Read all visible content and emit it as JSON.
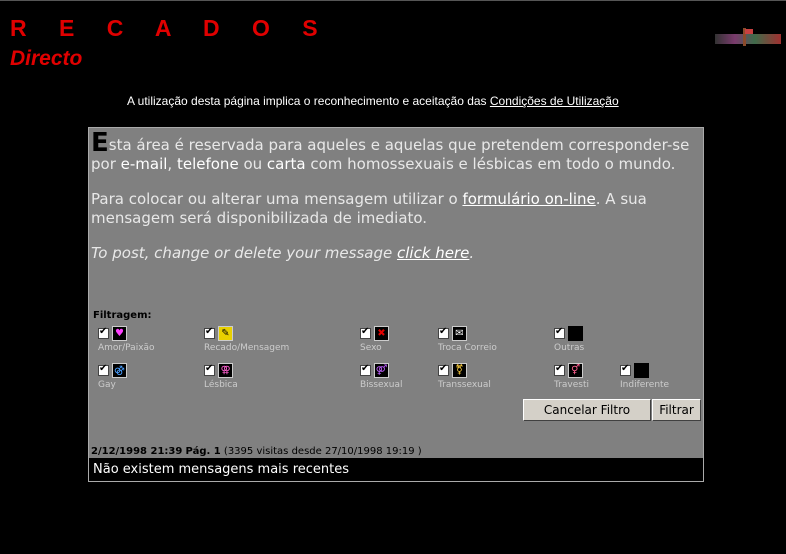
{
  "header": {
    "title": "R E C A D O S",
    "subtitle": "Directo"
  },
  "notice": {
    "text": "A utilização desta página implica o reconhecimento e aceitação das ",
    "link": "Condições de Utilização"
  },
  "intro": {
    "dropcap": "E",
    "p1_a": "sta área é reservada para aqueles e aquelas que pretendem corresponder-se por ",
    "email": "e-mail",
    "sep1": ", ",
    "phone": "telefone",
    "sep2": " ou ",
    "letter": "carta",
    "p1_b": " com homossexuais e lésbicas em todo o mundo.",
    "p2_a": "Para colocar ou alterar uma mensagem utilizar o ",
    "p2_link": "formulário on-line",
    "p2_b": ". A sua mensagem será disponibilizada de imediato.",
    "p3_a": "To post, change or delete your message ",
    "p3_link": "click here",
    "p3_b": "."
  },
  "filter": {
    "label": "Filtragem:",
    "items": [
      {
        "label": "Amor/Paixão",
        "icon": "heart-icon",
        "checked": true
      },
      {
        "label": "Recado/Mensagem",
        "icon": "note-icon",
        "checked": true
      },
      {
        "label": "Sexo",
        "icon": "sex-icon",
        "checked": true
      },
      {
        "label": "Troca Correio",
        "icon": "mail-icon",
        "checked": true
      },
      {
        "label": "Outras",
        "icon": "other-icon",
        "checked": true
      },
      {
        "label": "Gay",
        "icon": "gay-icon",
        "checked": true
      },
      {
        "label": "Lésbica",
        "icon": "lesbian-icon",
        "checked": true
      },
      {
        "label": "Bissexual",
        "icon": "bisexual-icon",
        "checked": true
      },
      {
        "label": "Transsexual",
        "icon": "transsexual-icon",
        "checked": true
      },
      {
        "label": "Travesti",
        "icon": "travesti-icon",
        "checked": true
      },
      {
        "label": "Indiferente",
        "icon": "indifferent-icon",
        "checked": true
      }
    ],
    "cancel_button": "Cancelar Filtro",
    "apply_button": "Filtrar"
  },
  "status": {
    "datetime": "2/12/1998 21:39",
    "page": "Pág. 1",
    "visits": "(3395 visitas desde 27/10/1998 19:19 )"
  },
  "messages": {
    "empty_text": "Não existem mensagens mais recentes"
  },
  "colors": {
    "brand_red": "#e00000",
    "panel_gray": "#808080"
  }
}
